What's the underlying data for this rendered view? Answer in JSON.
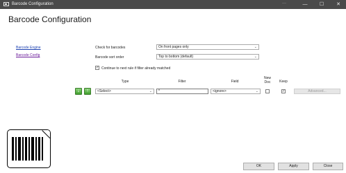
{
  "window": {
    "title": "Barcode Configuration",
    "dots": "···",
    "controls": {
      "minimize": "—",
      "maximize": "☐",
      "close": "✕"
    }
  },
  "page": {
    "title": "Barcode Configuration"
  },
  "sidebar": {
    "items": [
      {
        "label": "Barcode Engine"
      },
      {
        "label": "Barcode Config"
      }
    ]
  },
  "settings": {
    "check_for_barcodes": {
      "label": "Check for barcodes",
      "value": "On front pages only"
    },
    "sort_order": {
      "label": "Barcode sort order",
      "value": "Top to bottom (default)"
    },
    "continue_rule": {
      "label": "Continue to next rule if filter already matched",
      "checked": true
    }
  },
  "rule_table": {
    "headers": {
      "type": "Type",
      "filter": "Filter",
      "field": "Field",
      "new_doc_line1": "New",
      "new_doc_line2": "Doc",
      "keep": "Keep"
    },
    "row": {
      "type": "<Select>",
      "filter": "*",
      "field": "<ignore>",
      "new_doc": false,
      "keep": true,
      "advanced_label": "Advanced..."
    }
  },
  "icons": {
    "move_down": "arrow-down-icon",
    "move_up": "arrow-up-icon",
    "chevron": "chevron-down-icon",
    "checkmark": "✓"
  },
  "footer": {
    "ok": "OK",
    "apply": "Apply",
    "close": "Close"
  },
  "colors": {
    "titlebar": "#4a4a4a",
    "link": "#1a3fb0",
    "visited_link": "#6b1b9a",
    "arrow_green": "#3f9f2c"
  }
}
